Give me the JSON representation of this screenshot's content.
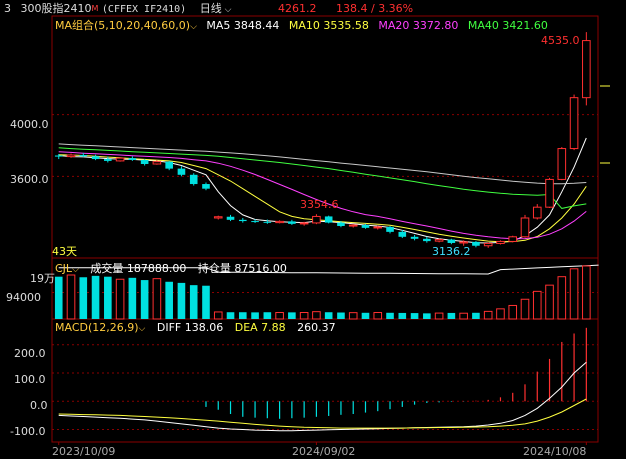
{
  "header": {
    "index": "3",
    "name": "300股指2410",
    "flag": "M",
    "code": "(CFFEX IF2410)",
    "period": "日线",
    "price": "4261.2",
    "change": "138.4 / 3.36%"
  },
  "ma_bar": {
    "label": "MA组合(5,10,20,40,60,0)",
    "ma5": "MA5 3848.44",
    "ma10": "MA10 3535.58",
    "ma20": "MA20 3372.80",
    "ma40": "MA40 3421.60"
  },
  "price_panel": {
    "high_label": "4535.0",
    "mid_label": "3354.6",
    "low_label": "3136.2",
    "days_label": "43天",
    "y_ticks": [
      "4000.0",
      "3600.0"
    ]
  },
  "volume_panel": {
    "label": "CJL",
    "volume": "成交量 187888.00",
    "open_interest": "持仓量 87516.00",
    "y_ticks": [
      "19万",
      "94000"
    ]
  },
  "macd_panel": {
    "label": "MACD(12,26,9)",
    "diff": "DIFF 138.06",
    "dea": "DEA 7.88",
    "macd": "260.37",
    "y_ticks": [
      "200.0",
      "100.0",
      "0.0",
      "-100.0"
    ]
  },
  "x_axis": {
    "ticks": [
      "2023/10/09",
      "2024/09/02",
      "2024/10/08"
    ]
  },
  "colors": {
    "up": "#ff3030",
    "down": "#00e0e0",
    "ma5": "#ffffff",
    "ma10": "#ffff40",
    "ma20": "#ff40ff",
    "ma40": "#40ff40",
    "ma60": "#c8c8c8",
    "grid": "#8a0000",
    "frame": "#8a0000"
  },
  "chart_data": {
    "type": "candlestick",
    "candles": [
      {
        "o": 3735,
        "h": 3745,
        "l": 3712,
        "c": 3728
      },
      {
        "o": 3728,
        "h": 3748,
        "l": 3720,
        "c": 3738
      },
      {
        "o": 3738,
        "h": 3752,
        "l": 3725,
        "c": 3730
      },
      {
        "o": 3730,
        "h": 3740,
        "l": 3705,
        "c": 3712
      },
      {
        "o": 3712,
        "h": 3728,
        "l": 3690,
        "c": 3700
      },
      {
        "o": 3700,
        "h": 3725,
        "l": 3695,
        "c": 3718
      },
      {
        "o": 3718,
        "h": 3730,
        "l": 3700,
        "c": 3706
      },
      {
        "o": 3706,
        "h": 3712,
        "l": 3670,
        "c": 3680
      },
      {
        "o": 3680,
        "h": 3705,
        "l": 3675,
        "c": 3695
      },
      {
        "o": 3695,
        "h": 3700,
        "l": 3640,
        "c": 3650
      },
      {
        "o": 3650,
        "h": 3665,
        "l": 3600,
        "c": 3610
      },
      {
        "o": 3610,
        "h": 3620,
        "l": 3540,
        "c": 3550
      },
      {
        "o": 3550,
        "h": 3560,
        "l": 3510,
        "c": 3520
      },
      {
        "o": 3330,
        "h": 3345,
        "l": 3320,
        "c": 3338
      },
      {
        "o": 3338,
        "h": 3350,
        "l": 3310,
        "c": 3318
      },
      {
        "o": 3318,
        "h": 3330,
        "l": 3300,
        "c": 3310
      },
      {
        "o": 3310,
        "h": 3322,
        "l": 3298,
        "c": 3305
      },
      {
        "o": 3305,
        "h": 3320,
        "l": 3292,
        "c": 3300
      },
      {
        "o": 3300,
        "h": 3315,
        "l": 3295,
        "c": 3308
      },
      {
        "o": 3308,
        "h": 3318,
        "l": 3285,
        "c": 3292
      },
      {
        "o": 3292,
        "h": 3305,
        "l": 3280,
        "c": 3298
      },
      {
        "o": 3298,
        "h": 3354.6,
        "l": 3290,
        "c": 3340
      },
      {
        "o": 3340,
        "h": 3345,
        "l": 3295,
        "c": 3300
      },
      {
        "o": 3300,
        "h": 3310,
        "l": 3270,
        "c": 3278
      },
      {
        "o": 3278,
        "h": 3290,
        "l": 3268,
        "c": 3284
      },
      {
        "o": 3284,
        "h": 3292,
        "l": 3260,
        "c": 3266
      },
      {
        "o": 3266,
        "h": 3280,
        "l": 3255,
        "c": 3272
      },
      {
        "o": 3272,
        "h": 3278,
        "l": 3230,
        "c": 3240
      },
      {
        "o": 3240,
        "h": 3252,
        "l": 3200,
        "c": 3208
      },
      {
        "o": 3208,
        "h": 3220,
        "l": 3185,
        "c": 3195
      },
      {
        "o": 3195,
        "h": 3208,
        "l": 3170,
        "c": 3180
      },
      {
        "o": 3180,
        "h": 3198,
        "l": 3172,
        "c": 3190
      },
      {
        "o": 3190,
        "h": 3195,
        "l": 3160,
        "c": 3168
      },
      {
        "o": 3168,
        "h": 3185,
        "l": 3150,
        "c": 3175
      },
      {
        "o": 3175,
        "h": 3180,
        "l": 3140,
        "c": 3150
      },
      {
        "o": 3150,
        "h": 3172,
        "l": 3136.2,
        "c": 3165
      },
      {
        "o": 3165,
        "h": 3185,
        "l": 3158,
        "c": 3178
      },
      {
        "o": 3178,
        "h": 3215,
        "l": 3172,
        "c": 3208
      },
      {
        "o": 3208,
        "h": 3350,
        "l": 3202,
        "c": 3330
      },
      {
        "o": 3330,
        "h": 3420,
        "l": 3320,
        "c": 3400
      },
      {
        "o": 3400,
        "h": 3590,
        "l": 3395,
        "c": 3580
      },
      {
        "o": 3580,
        "h": 3790,
        "l": 3575,
        "c": 3780
      },
      {
        "o": 3780,
        "h": 4130,
        "l": 3770,
        "c": 4110
      },
      {
        "o": 4110,
        "h": 4535,
        "l": 4060,
        "c": 4480
      }
    ],
    "volume": [
      150000,
      156000,
      148000,
      153000,
      150000,
      141000,
      146000,
      138000,
      143000,
      132000,
      128000,
      120000,
      118000,
      25000,
      24000,
      24000,
      23500,
      24000,
      23000,
      23500,
      23000,
      26000,
      24000,
      23000,
      22500,
      22000,
      23000,
      22000,
      21500,
      21000,
      20000,
      21000,
      21500,
      20500,
      22000,
      27000,
      36000,
      48000,
      70000,
      98000,
      120000,
      150000,
      178000,
      188000,
      187888
    ],
    "macd_hist": [
      0,
      0,
      0,
      0,
      0,
      0,
      0,
      0,
      0,
      0,
      0,
      0,
      -20,
      -30,
      -45,
      -55,
      -58,
      -60,
      -62,
      -60,
      -58,
      -55,
      -52,
      -48,
      -45,
      -40,
      -35,
      -28,
      -20,
      -12,
      -6,
      -4,
      -2,
      -1,
      2,
      5,
      14,
      30,
      60,
      105,
      150,
      210,
      240,
      260
    ],
    "ma_series": {
      "ma5": [
        3735,
        3728,
        3726,
        3720,
        3715,
        3712,
        3710,
        3705,
        3700,
        3690,
        3670,
        3640,
        3610,
        3500,
        3410,
        3350,
        3320,
        3312,
        3305,
        3302,
        3300,
        3310,
        3305,
        3300,
        3292,
        3284,
        3278,
        3268,
        3250,
        3230,
        3210,
        3195,
        3185,
        3178,
        3170,
        3168,
        3172,
        3180,
        3215,
        3270,
        3350,
        3500,
        3660,
        3848.44
      ],
      "ma10": [
        3740,
        3738,
        3735,
        3730,
        3725,
        3720,
        3715,
        3710,
        3705,
        3700,
        3690,
        3670,
        3650,
        3610,
        3570,
        3520,
        3470,
        3420,
        3370,
        3340,
        3325,
        3318,
        3312,
        3305,
        3300,
        3295,
        3290,
        3283,
        3270,
        3255,
        3240,
        3225,
        3212,
        3200,
        3190,
        3180,
        3176,
        3177,
        3185,
        3210,
        3260,
        3330,
        3420,
        3535.58
      ],
      "ma20": [
        3760,
        3755,
        3750,
        3746,
        3742,
        3738,
        3734,
        3730,
        3726,
        3722,
        3716,
        3708,
        3700,
        3685,
        3665,
        3640,
        3612,
        3580,
        3548,
        3515,
        3482,
        3450,
        3420,
        3392,
        3370,
        3352,
        3340,
        3325,
        3308,
        3292,
        3278,
        3262,
        3245,
        3230,
        3218,
        3208,
        3200,
        3195,
        3196,
        3205,
        3225,
        3260,
        3310,
        3372.8
      ],
      "ma40": [
        3785,
        3780,
        3776,
        3772,
        3768,
        3764,
        3760,
        3756,
        3752,
        3748,
        3744,
        3740,
        3736,
        3730,
        3722,
        3714,
        3706,
        3698,
        3690,
        3680,
        3670,
        3660,
        3650,
        3638,
        3626,
        3614,
        3602,
        3590,
        3578,
        3566,
        3552,
        3540,
        3528,
        3516,
        3506,
        3498,
        3490,
        3484,
        3480,
        3478,
        3482,
        3392,
        3408,
        3421.6
      ],
      "ma60": [
        3810,
        3806,
        3802,
        3798,
        3794,
        3790,
        3786,
        3782,
        3778,
        3774,
        3770,
        3766,
        3762,
        3757,
        3752,
        3746,
        3740,
        3733,
        3726,
        3718,
        3710,
        3702,
        3694,
        3686,
        3678,
        3670,
        3662,
        3654,
        3646,
        3638,
        3630,
        3620,
        3610,
        3600,
        3592,
        3584,
        3576,
        3568,
        3562,
        3556,
        3552,
        3552,
        3555,
        3560
      ]
    },
    "macd_lines": {
      "diff": [
        -50,
        -52,
        -54,
        -56,
        -58,
        -60,
        -63,
        -66,
        -70,
        -75,
        -80,
        -85,
        -90,
        -95,
        -98,
        -100,
        -102,
        -103,
        -104,
        -104,
        -103,
        -102,
        -101,
        -100,
        -99,
        -98,
        -97,
        -96,
        -95,
        -94,
        -93,
        -92,
        -91,
        -90,
        -88,
        -84,
        -78,
        -68,
        -50,
        -25,
        10,
        50,
        100,
        138.06
      ],
      "dea": [
        -45,
        -46,
        -47,
        -48,
        -49,
        -50,
        -52,
        -54,
        -56,
        -58,
        -61,
        -64,
        -67,
        -70,
        -74,
        -78,
        -82,
        -85,
        -88,
        -90,
        -92,
        -93,
        -94,
        -95,
        -95,
        -95,
        -95,
        -95,
        -95,
        -94,
        -94,
        -93,
        -93,
        -92,
        -91,
        -90,
        -88,
        -85,
        -80,
        -70,
        -56,
        -38,
        -15,
        7.88
      ]
    }
  }
}
